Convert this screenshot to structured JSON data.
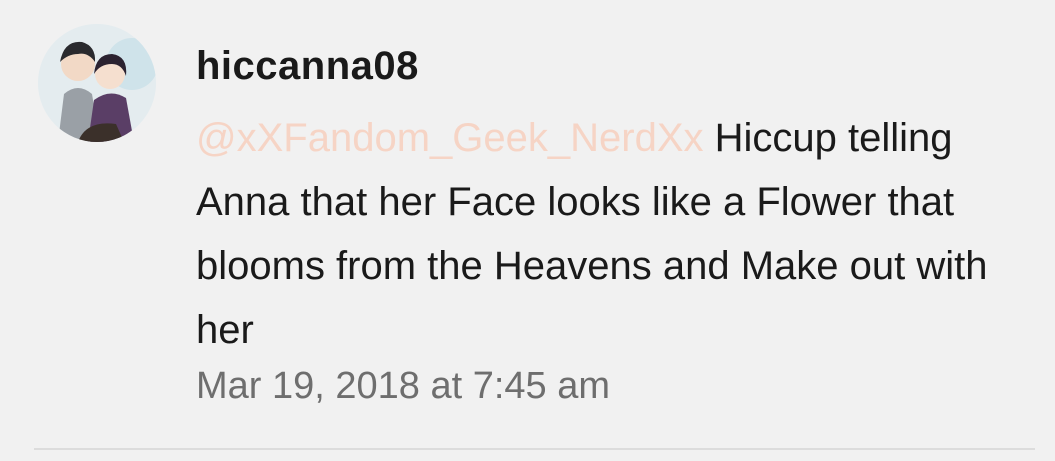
{
  "comment": {
    "username": "hiccanna08",
    "mention": "@xXFandom_Geek_NerdXx",
    "text": " Hiccup telling Anna that her Face looks like a Flower that blooms from the Heavens and Make out with her",
    "timestamp": "Mar 19, 2018 at 7:45 am",
    "avatar_icon": "user-avatar-illustration"
  },
  "colors": {
    "background": "#f1f1f1",
    "text": "#1a1a1a",
    "mention": "#f6d4c5",
    "timestamp": "#6e6e6e"
  }
}
